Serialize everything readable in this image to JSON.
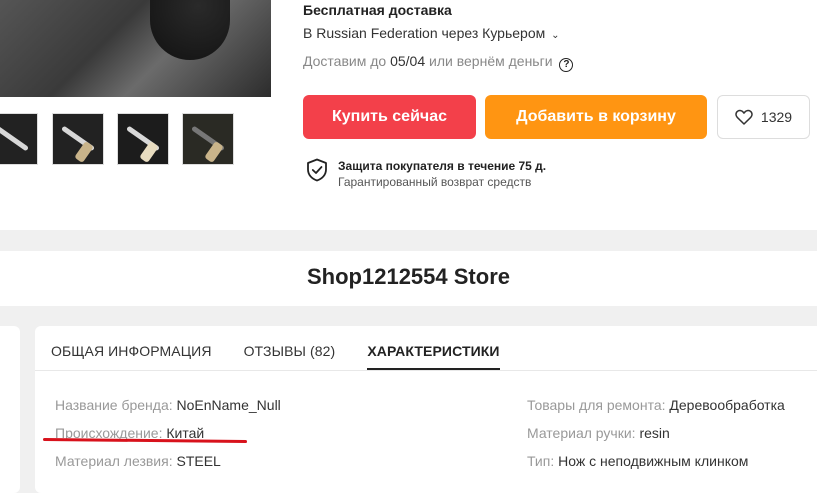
{
  "shipping": {
    "title": "Бесплатная доставка",
    "via": "В Russian Federation через Курьером",
    "chevron": "⌄",
    "guarantee_prefix": "Доставим до",
    "guarantee_date": "05/04",
    "guarantee_suffix": "или вернём деньги",
    "help_icon": "?"
  },
  "buttons": {
    "buy_now": "Купить сейчас",
    "add_to_cart": "Добавить в корзину",
    "wishlist_count": "1329"
  },
  "protection": {
    "title": "Защита покупателя в течение 75 д.",
    "subtitle": "Гарантированный возврат средств"
  },
  "store": {
    "name": "Shop1212554 Store"
  },
  "tabs": [
    {
      "label": "ОБЩАЯ ИНФОРМАЦИЯ",
      "active": false
    },
    {
      "label": "ОТЗЫВЫ (82)",
      "active": false
    },
    {
      "label": "ХАРАКТЕРИСТИКИ",
      "active": true
    }
  ],
  "specs_left": [
    {
      "key": "Название бренда:",
      "value": "NoEnName_Null"
    },
    {
      "key": "Происхождение:",
      "value": "Китай"
    },
    {
      "key": "Материал лезвия:",
      "value": "STEEL"
    }
  ],
  "specs_right": [
    {
      "key": "Товары для ремонта:",
      "value": "Деревообработка"
    },
    {
      "key": "Материал ручки:",
      "value": "resin"
    },
    {
      "key": "Тип:",
      "value": "Нож с неподвижным клинком"
    }
  ],
  "colors": {
    "buy_button": "#f3404a",
    "cart_button": "#ff9512",
    "annotation_underline": "#d8121c"
  }
}
